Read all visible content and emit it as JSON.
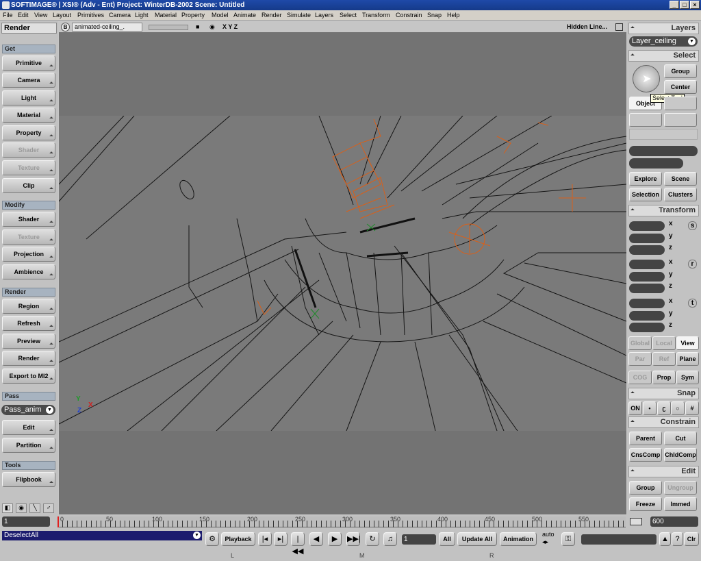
{
  "titlebar": {
    "title": "SOFTIMAGE® | XSI® (Adv - Ent) Project: WinterDB-2002    Scene: Untitled",
    "min": "_",
    "max": "□",
    "close": "×"
  },
  "menu": [
    "File",
    "Edit",
    "View",
    "Layout",
    "Primitives",
    "Camera",
    "Light",
    "Material",
    "Property",
    "Model",
    "Animate",
    "Render",
    "Simulate",
    "Layers",
    "Select",
    "Transform",
    "Constrain",
    "Snap",
    "Help"
  ],
  "left": {
    "title": "Render",
    "get_head": "Get",
    "get_items": [
      "Primitive",
      "Camera",
      "Light",
      "Material",
      "Property",
      "Shader",
      "Texture",
      "Clip"
    ],
    "modify_head": "Modify",
    "modify_items": [
      "Shader",
      "Texture",
      "Projection",
      "Ambience"
    ],
    "render_head": "Render",
    "render_items": [
      "Region",
      "Refresh",
      "Preview",
      "Render",
      "Export to MI2"
    ],
    "pass_head": "Pass",
    "pass_value": "Pass_anim",
    "pass_items": [
      "Edit",
      "Partition"
    ],
    "tools_head": "Tools",
    "tools_items": [
      "Flipbook"
    ]
  },
  "viewport": {
    "tab_letter": "B",
    "camera_name": "animated-ceiling_.",
    "xyz": "X Y Z",
    "display_mode": "Hidden Line...",
    "axis_y": "Y",
    "axis_x": "X",
    "axis_z": "Z"
  },
  "right": {
    "layers_head": "Layers",
    "layer_value": "Layer_ceiling",
    "select_head": "Select",
    "group": "Group",
    "center": "Center",
    "object": "Object",
    "tooltip": "Select Tool",
    "explore": "Explore",
    "scene": "Scene",
    "selection": "Selection",
    "clusters": "Clusters",
    "transform_head": "Transform",
    "x": "x",
    "y": "y",
    "z": "z",
    "s": "s",
    "r": "r",
    "t": "t",
    "global": "Global",
    "local": "Local",
    "view": "View",
    "par": "Par",
    "ref": "Ref",
    "plane": "Plane",
    "cog": "COG",
    "prop": "Prop",
    "sym": "Sym",
    "snap_head": "Snap",
    "snap_on": "ON",
    "constrain_head": "Constrain",
    "parent": "Parent",
    "cut": "Cut",
    "cnscomp": "CnsComp",
    "chldcomp": "ChldComp",
    "edit_head": "Edit",
    "egroup": "Group",
    "ungroup": "Ungroup",
    "freeze": "Freeze",
    "immed": "Immed"
  },
  "timeline": {
    "start": "1",
    "end": "600",
    "ticks": [
      "0",
      "50",
      "100",
      "150",
      "200",
      "250",
      "300",
      "350",
      "400",
      "450",
      "500",
      "550"
    ]
  },
  "bottom": {
    "command": "DeselectAll",
    "playback": "Playback",
    "frame": "1",
    "all": "All",
    "update_all": "Update All",
    "animation": "Animation",
    "auto": "auto",
    "clr": "Clr",
    "mouse_l": "L",
    "mouse_m": "M",
    "mouse_r": "R"
  },
  "colors": {
    "title": "#1f4aa8",
    "viewport": "#737373",
    "wire": "#151515",
    "highlight": "#d9601a"
  }
}
